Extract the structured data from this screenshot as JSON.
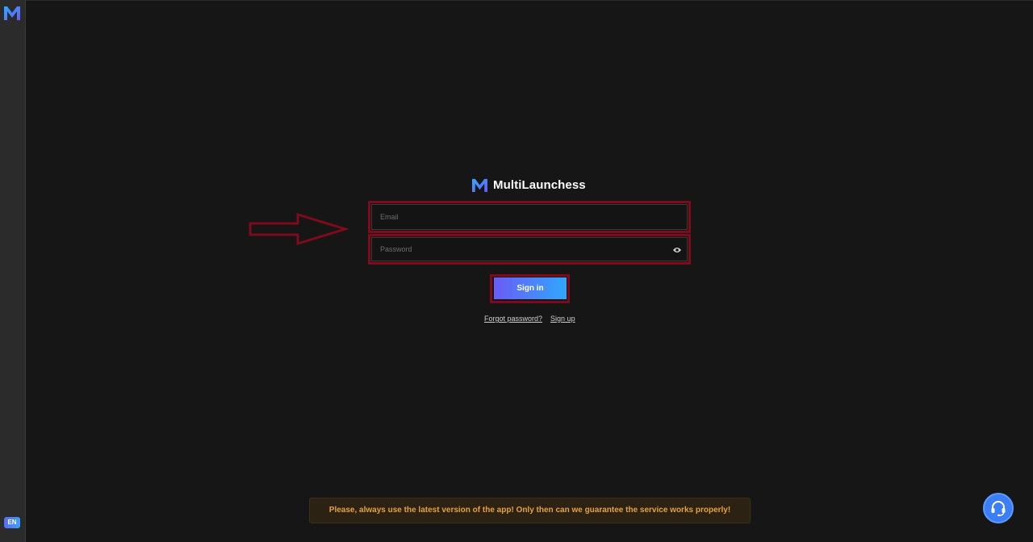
{
  "app": {
    "brand_name": "MultiLaunchess",
    "language": "EN"
  },
  "login": {
    "email_placeholder": "Email",
    "password_placeholder": "Password",
    "signin_label": "Sign in",
    "forgot_password_label": "Forgot password?",
    "signup_label": "Sign up"
  },
  "notice": {
    "text": "Please, always use the latest version of the app! Only then can we guarantee the service works properly!"
  },
  "icons": {
    "logo": "logo-icon",
    "eye": "eye-icon",
    "support": "headset-icon",
    "arrow": "arrow-right-icon"
  },
  "colors": {
    "background": "#161616",
    "sidebar": "#2b2b2b",
    "highlight": "#7d0b1c",
    "accent_start": "#6a5cf5",
    "accent_end": "#2fa8ff",
    "notice_text": "#e7a13a"
  }
}
